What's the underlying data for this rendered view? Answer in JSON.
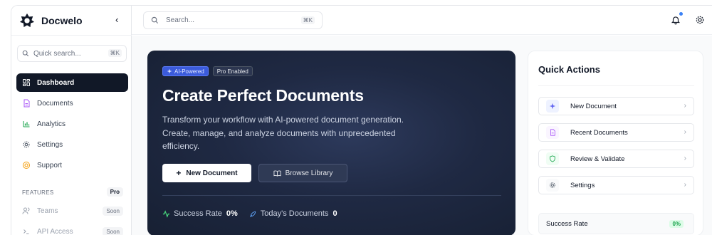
{
  "brand": {
    "name": "Docwelo"
  },
  "sidebar": {
    "quick_search": {
      "placeholder": "Quick search...",
      "shortcut": "⌘K"
    },
    "items": [
      {
        "label": "Dashboard",
        "icon": "dashboard-icon",
        "active": true
      },
      {
        "label": "Documents",
        "icon": "document-icon",
        "active": false
      },
      {
        "label": "Analytics",
        "icon": "analytics-icon",
        "active": false
      },
      {
        "label": "Settings",
        "icon": "gear-icon",
        "active": false
      },
      {
        "label": "Support",
        "icon": "support-icon",
        "active": false
      }
    ],
    "features": {
      "heading": "FEATURES",
      "badge": "Pro",
      "items": [
        {
          "label": "Teams",
          "status": "Soon",
          "icon": "users-icon"
        },
        {
          "label": "API Access",
          "status": "Soon",
          "icon": "code-icon"
        }
      ]
    }
  },
  "topbar": {
    "search": {
      "placeholder": "Search...",
      "shortcut": "⌘K"
    }
  },
  "hero": {
    "badge_ai": "AI-Powered",
    "badge_pro": "Pro Enabled",
    "title": "Create Perfect Documents",
    "description": "Transform your workflow with AI-powered document generation. Create, manage, and analyze documents with unprecedented efficiency.",
    "new_document_label": "New Document",
    "browse_library_label": "Browse Library",
    "stats": [
      {
        "label": "Success Rate",
        "value": "0%"
      },
      {
        "label": "Today's Documents",
        "value": "0"
      }
    ]
  },
  "quick_actions": {
    "title": "Quick Actions",
    "items": [
      {
        "label": "New Document",
        "icon": "sparkle-icon",
        "color": "#6366f1",
        "bg": "#eef2ff"
      },
      {
        "label": "Recent Documents",
        "icon": "file-icon",
        "color": "#a855f7",
        "bg": "#faf5ff"
      },
      {
        "label": "Review & Validate",
        "icon": "shield-icon",
        "color": "#16a34a",
        "bg": "#f0fdf4"
      },
      {
        "label": "Settings",
        "icon": "gear-icon",
        "color": "#4b5563",
        "bg": "#f9fafb"
      }
    ],
    "success_rate_label": "Success Rate",
    "success_rate_value": "0%"
  },
  "colors": {
    "accent": "#3b5bdb",
    "sidebar_active": "#111827",
    "hero_bg": "#1f2943",
    "notification": "#3b82f6"
  }
}
